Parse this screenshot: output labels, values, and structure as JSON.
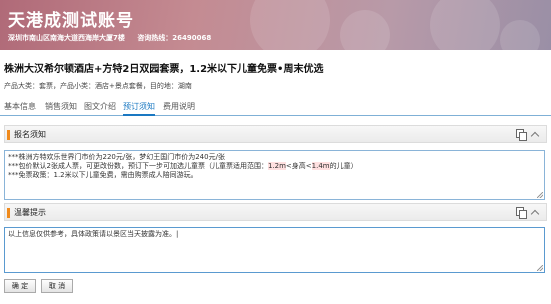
{
  "header": {
    "title": "天港成测试账号",
    "address": "深圳市南山区南海大道西海岸大厦7楼",
    "hotline": "咨询热线：26490068"
  },
  "product": {
    "title": "株洲大汉希尔顿酒店+方特2日双园套票，1.2米以下儿童免票•周末优选",
    "meta": "产品大类：套票，产品小类：酒店+景点套餐，目的地：湖南"
  },
  "tabs": [
    {
      "label": "基本信息",
      "active": false
    },
    {
      "label": "销售须知",
      "active": false
    },
    {
      "label": "图文介绍",
      "active": false
    },
    {
      "label": "预订须知",
      "active": true
    },
    {
      "label": "费用说明",
      "active": false
    }
  ],
  "booking_notice": {
    "label": "报名须知",
    "lines": [
      "***株洲方特欢乐世界门市价为220元/张，梦幻王国门市价为240元/张",
      "***包价默认2张成人票，可更改份数，预订下一步可加选儿童票（儿童票适用范围：",
      "***免票政策：1.2米以下儿童免费，需由购票成人陪同游玩。"
    ],
    "line2_hl1": "1.2m",
    "line2_mid": "<身高<",
    "line2_hl2": "1.4m",
    "line2_end": "的儿童）"
  },
  "tips": {
    "label": "温馨提示",
    "text": "以上信息仅供参考，具体政策请以景区当天披露为准。|"
  },
  "buttons": {
    "confirm": "确 定",
    "cancel": "取 消"
  }
}
